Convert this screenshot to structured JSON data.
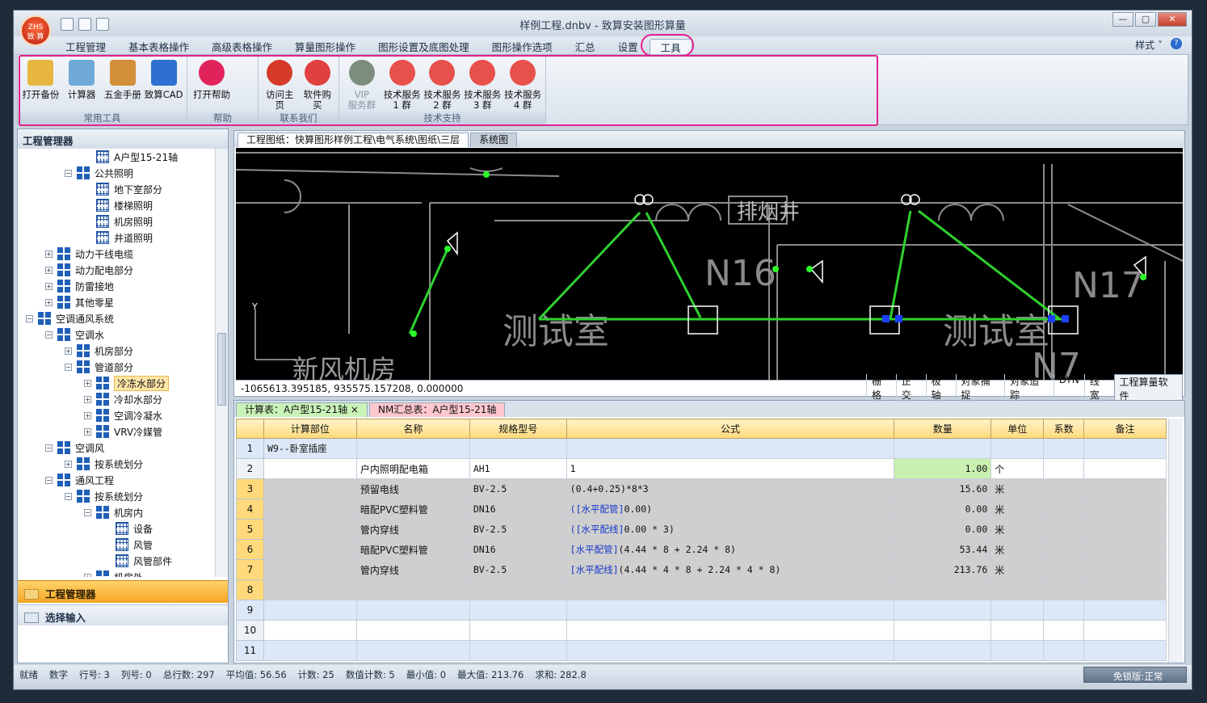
{
  "window": {
    "title": "样例工程.dnbv - 致算安装图形算量",
    "logo": "ZHS",
    "logo_sub": "致·算"
  },
  "menu": {
    "items": [
      "工程管理",
      "基本表格操作",
      "高级表格操作",
      "算量图形操作",
      "图形设置及底图处理",
      "图形操作选项",
      "汇总",
      "设置",
      "工具"
    ],
    "style_label": "样式",
    "help_icon": "help-icon"
  },
  "ribbon": {
    "groups": [
      {
        "label": "常用工具",
        "buttons": [
          "打开备份",
          "计算器",
          "五金手册",
          "致算CAD"
        ]
      },
      {
        "label": "帮助",
        "buttons": [
          "打开帮助"
        ]
      },
      {
        "label": "联系我们",
        "buttons": [
          "访问主页",
          "软件购买"
        ]
      },
      {
        "label": "技术支持",
        "buttons": [
          [
            "VIP",
            "服务群"
          ],
          [
            "技术服务",
            "1 群"
          ],
          [
            "技术服务",
            "2 群"
          ],
          [
            "技术服务",
            "3 群"
          ],
          [
            "技术服务",
            "4 群"
          ]
        ]
      }
    ]
  },
  "left_panel": {
    "title": "工程管理器",
    "tree": [
      {
        "label": "A户型15-21轴",
        "level": 5,
        "icon": "table"
      },
      {
        "label": "公共照明",
        "level": 4,
        "icon": "folder",
        "toggle": "−"
      },
      {
        "label": "地下室部分",
        "level": 5,
        "icon": "table"
      },
      {
        "label": "楼梯照明",
        "level": 5,
        "icon": "table"
      },
      {
        "label": "机房照明",
        "level": 5,
        "icon": "table"
      },
      {
        "label": "井道照明",
        "level": 5,
        "icon": "table"
      },
      {
        "label": "动力干线电缆",
        "level": 3,
        "icon": "folder",
        "toggle": "+"
      },
      {
        "label": "动力配电部分",
        "level": 3,
        "icon": "folder",
        "toggle": "+"
      },
      {
        "label": "防雷接地",
        "level": 3,
        "icon": "folder",
        "toggle": "+"
      },
      {
        "label": "其他零星",
        "level": 3,
        "icon": "folder",
        "toggle": "+"
      },
      {
        "label": "空调通风系统",
        "level": 2,
        "icon": "folder",
        "toggle": "−"
      },
      {
        "label": "空调水",
        "level": 3,
        "icon": "folder",
        "toggle": "−"
      },
      {
        "label": "机房部分",
        "level": 4,
        "icon": "folder",
        "toggle": "+"
      },
      {
        "label": "管道部分",
        "level": 4,
        "icon": "folder",
        "toggle": "−"
      },
      {
        "label": "冷冻水部分",
        "level": 5,
        "icon": "folder",
        "toggle": "+",
        "selected": true
      },
      {
        "label": "冷却水部分",
        "level": 5,
        "icon": "folder",
        "toggle": "+"
      },
      {
        "label": "空调冷凝水",
        "level": 5,
        "icon": "folder",
        "toggle": "+"
      },
      {
        "label": "VRV冷媒管",
        "level": 5,
        "icon": "folder",
        "toggle": "+"
      },
      {
        "label": "空调风",
        "level": 3,
        "icon": "folder",
        "toggle": "−"
      },
      {
        "label": "按系统划分",
        "level": 4,
        "icon": "folder",
        "toggle": "+"
      },
      {
        "label": "通风工程",
        "level": 3,
        "icon": "folder",
        "toggle": "−"
      },
      {
        "label": "按系统划分",
        "level": 4,
        "icon": "folder",
        "toggle": "−"
      },
      {
        "label": "机房内",
        "level": 5,
        "icon": "folder",
        "toggle": "−"
      },
      {
        "label": "设备",
        "level": 6,
        "icon": "table"
      },
      {
        "label": "风管",
        "level": 6,
        "icon": "table"
      },
      {
        "label": "风管部件",
        "level": 6,
        "icon": "table"
      },
      {
        "label": "机房外",
        "level": 5,
        "icon": "folder",
        "toggle": "+"
      }
    ],
    "nav_items": [
      "工程管理器",
      "选择输入"
    ]
  },
  "cad": {
    "tabs": [
      "工程图纸：快算图形样例工程\\电气系统\\图纸\\三层",
      "系统图"
    ],
    "texts": [
      "测试室",
      "测试室",
      "新风机房",
      "N16",
      "N17",
      "N7",
      "排烟井"
    ],
    "coords": "-1065613.395185, 935575.157208, 0.000000",
    "toggles": [
      "栅格",
      "正交",
      "极轴",
      "对象捕捉",
      "对象追踪",
      "DYN",
      "线宽",
      "工程算量软件"
    ]
  },
  "sheet": {
    "tabs": [
      "计算表：A户型15-21轴",
      "NM汇总表：A户型15-21轴"
    ],
    "headers": [
      "",
      "计算部位",
      "名称",
      "规格型号",
      "公式",
      "数量",
      "单位",
      "系数",
      "备注"
    ],
    "rows": [
      {
        "n": "1",
        "part": "W9--卧室插座",
        "name": "",
        "spec": "",
        "formula_tag": "",
        "formula": "",
        "qty": "",
        "unit": "",
        "coef": "",
        "note": ""
      },
      {
        "n": "2",
        "part": "",
        "name": "户内照明配电箱",
        "spec": "AH1",
        "formula_tag": "",
        "formula": "1",
        "qty": "1.00",
        "unit": "个",
        "coef": "",
        "note": ""
      },
      {
        "n": "3",
        "part": "",
        "name": "预留电线",
        "spec": "BV-2.5",
        "formula_tag": "",
        "formula": "(0.4+0.25)*8*3",
        "qty": "15.60",
        "unit": "米",
        "coef": "",
        "note": ""
      },
      {
        "n": "4",
        "part": "",
        "name": "暗配PVC塑料管",
        "spec": "DN16",
        "formula_tag": "([水平配管]",
        "formula": "0.00)",
        "qty": "0.00",
        "unit": "米",
        "coef": "",
        "note": ""
      },
      {
        "n": "5",
        "part": "",
        "name": "管内穿线",
        "spec": "BV-2.5",
        "formula_tag": "([水平配线]",
        "formula": "0.00 * 3)",
        "qty": "0.00",
        "unit": "米",
        "coef": "",
        "note": ""
      },
      {
        "n": "6",
        "part": "",
        "name": "暗配PVC塑料管",
        "spec": "DN16",
        "formula_tag": "[水平配管]",
        "formula": "(4.44 * 8 + 2.24 * 8)",
        "qty": "53.44",
        "unit": "米",
        "coef": "",
        "note": ""
      },
      {
        "n": "7",
        "part": "",
        "name": "管内穿线",
        "spec": "BV-2.5",
        "formula_tag": "[水平配线]",
        "formula": "(4.44 * 4 * 8 + 2.24 * 4 * 8)",
        "qty": "213.76",
        "unit": "米",
        "coef": "",
        "note": ""
      },
      {
        "n": "8",
        "part": "",
        "name": "",
        "spec": "",
        "formula_tag": "",
        "formula": "",
        "qty": "",
        "unit": "",
        "coef": "",
        "note": ""
      },
      {
        "n": "9",
        "part": "",
        "name": "",
        "spec": "",
        "formula_tag": "",
        "formula": "",
        "qty": "",
        "unit": "",
        "coef": "",
        "note": ""
      },
      {
        "n": "10",
        "part": "",
        "name": "",
        "spec": "",
        "formula_tag": "",
        "formula": "",
        "qty": "",
        "unit": "",
        "coef": "",
        "note": ""
      },
      {
        "n": "11",
        "part": "",
        "name": "",
        "spec": "",
        "formula_tag": "",
        "formula": "",
        "qty": "",
        "unit": "",
        "coef": "",
        "note": ""
      }
    ]
  },
  "status": {
    "items": [
      "就绪",
      "数字",
      "行号: 3",
      "列号: 0",
      "总行数: 297",
      "平均值: 56.56",
      "计数: 25",
      "数值计数: 5",
      "最小值: 0",
      "最大值: 213.76",
      "求和: 282.8"
    ],
    "lock": "免锁版:正常"
  }
}
